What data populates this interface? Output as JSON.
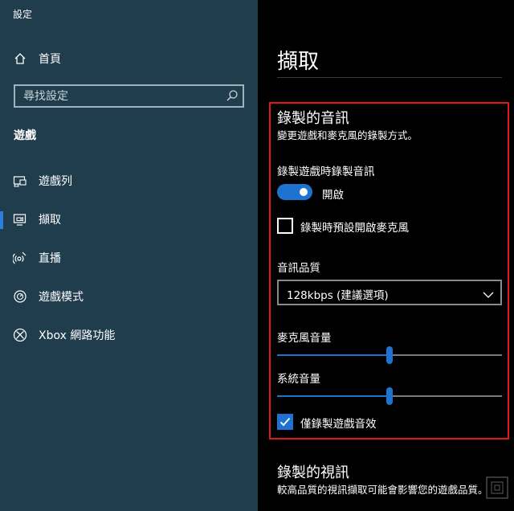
{
  "app": {
    "title": "設定"
  },
  "sidebar": {
    "home_label": "首頁",
    "search_placeholder": "尋找設定",
    "section_heading": "遊戲",
    "items": [
      {
        "label": "遊戲列",
        "icon": "game-bar-icon"
      },
      {
        "label": "擷取",
        "icon": "capture-icon",
        "active": true
      },
      {
        "label": "直播",
        "icon": "broadcast-icon"
      },
      {
        "label": "遊戲模式",
        "icon": "game-mode-icon"
      },
      {
        "label": "Xbox 網路功能",
        "icon": "xbox-icon"
      }
    ]
  },
  "main": {
    "page_title": "擷取",
    "audio_section": {
      "title": "錄製的音訊",
      "description": "變更遊戲和麥克風的錄製方式。",
      "record_audio_label": "錄製遊戲時錄製音訊",
      "record_audio_toggle_state": "開啟",
      "mic_default_label": "錄製時預設開啟麥克風",
      "mic_default_checked": false,
      "quality_label": "音訊品質",
      "quality_value": "128kbps (建議選項)",
      "mic_volume_label": "麥克風音量",
      "mic_volume": 0.5,
      "system_volume_label": "系統音量",
      "system_volume": 0.5,
      "game_audio_only_label": "僅錄製遊戲音效",
      "game_audio_only_checked": true
    },
    "video_section": {
      "title": "錄製的視訊",
      "description": "較高品質的視訊擷取可能會影響您的遊戲品質。"
    }
  },
  "colors": {
    "sidebar_bg": "#1f3d4c",
    "accent": "#1e73d0",
    "highlight_border": "#e0181c"
  }
}
